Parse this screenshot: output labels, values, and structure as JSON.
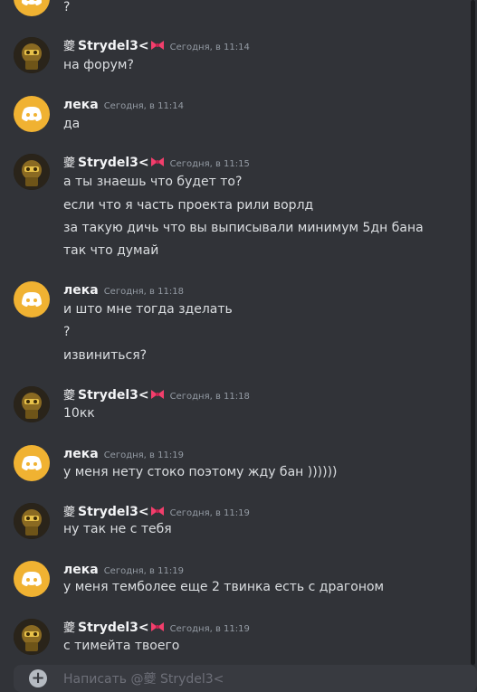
{
  "top_partial": {
    "text": "?"
  },
  "messages": [
    {
      "author": "Strydel3<",
      "flag": "夔",
      "time": "Сегодня, в 11:14",
      "lines": [
        "на форум?"
      ]
    },
    {
      "author": "лека",
      "time": "Сегодня, в 11:14",
      "lines": [
        "да"
      ]
    },
    {
      "author": "Strydel3<",
      "flag": "夔",
      "time": "Сегодня, в 11:15",
      "lines": [
        "а ты знаешь что будет то?",
        "если что я часть проекта рили ворлд",
        "за такую дичь что вы выписывали минимум 5дн бана",
        "так что думай"
      ]
    },
    {
      "author": "лека",
      "time": "Сегодня, в 11:18",
      "lines": [
        "и што мне тогда зделать",
        "?",
        "извиниться?"
      ]
    },
    {
      "author": "Strydel3<",
      "flag": "夔",
      "time": "Сегодня, в 11:18",
      "lines": [
        "10кк"
      ]
    },
    {
      "author": "лека",
      "time": "Сегодня, в 11:19",
      "lines": [
        "у меня нету стоко поэтому жду бан ))))))"
      ]
    },
    {
      "author": "Strydel3<",
      "flag": "夔",
      "time": "Сегодня, в 11:19",
      "lines": [
        "ну так не с тебя"
      ]
    },
    {
      "author": "лека",
      "time": "Сегодня, в 11:19",
      "lines": [
        "у меня темболее еще 2 твинка есть с драгоном"
      ]
    },
    {
      "author": "Strydel3<",
      "flag": "夔",
      "time": "Сегодня, в 11:19",
      "lines": [
        "с тимейта твоего"
      ]
    }
  ],
  "composer": {
    "placeholder": "Написать @夔 Strydel3<"
  },
  "colors": {
    "background": "#313338",
    "discord_avatar": "#f0b232",
    "text": "#dbdee1",
    "muted": "#949ba4",
    "bow": "#f23f6c"
  }
}
